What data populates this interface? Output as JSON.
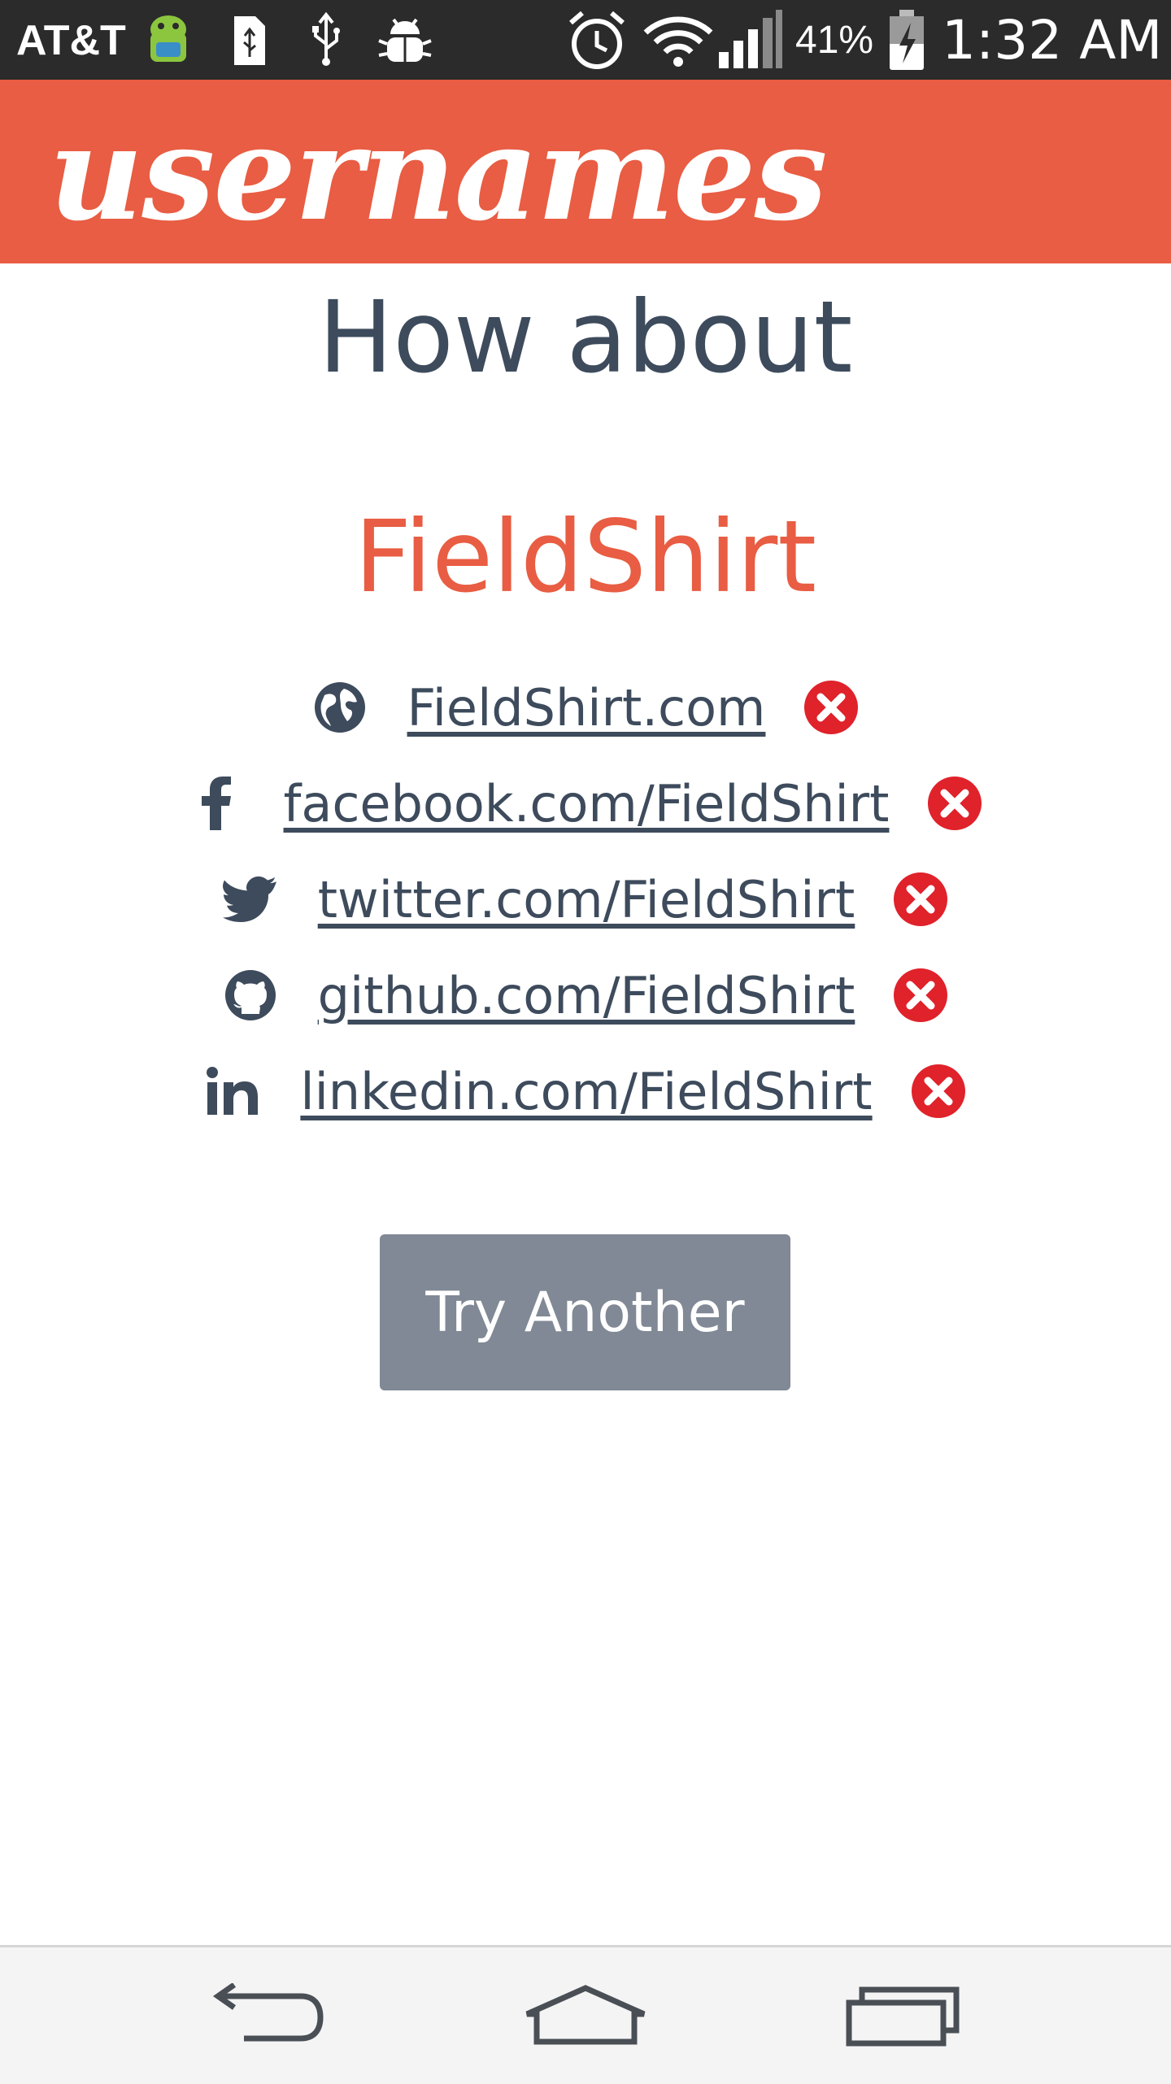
{
  "status_bar": {
    "carrier": "AT&T",
    "battery_percent": "41%",
    "time": "1:32 AM",
    "icons": [
      "android-icon",
      "sd-card-icon",
      "usb-icon",
      "debug-icon",
      "alarm-icon",
      "wifi-icon",
      "signal-icon",
      "battery-charging-icon"
    ]
  },
  "app": {
    "logo_text": "usernames",
    "accent_color": "#e85d43"
  },
  "main": {
    "headline": "How about",
    "suggestion": "FieldShirt",
    "availability": [
      {
        "icon": "globe-icon",
        "link": "FieldShirt.com",
        "status": "unavailable"
      },
      {
        "icon": "facebook-icon",
        "link": "facebook.com/FieldShirt",
        "status": "unavailable"
      },
      {
        "icon": "twitter-icon",
        "link": "twitter.com/FieldShirt",
        "status": "unavailable"
      },
      {
        "icon": "github-icon",
        "link": "github.com/FieldShirt",
        "status": "unavailable"
      },
      {
        "icon": "linkedin-icon",
        "link": "linkedin.com/FieldShirt",
        "status": "unavailable"
      }
    ],
    "try_another_label": "Try Another"
  },
  "nav_bar": {
    "buttons": [
      "back-icon",
      "home-icon",
      "recents-icon"
    ]
  }
}
